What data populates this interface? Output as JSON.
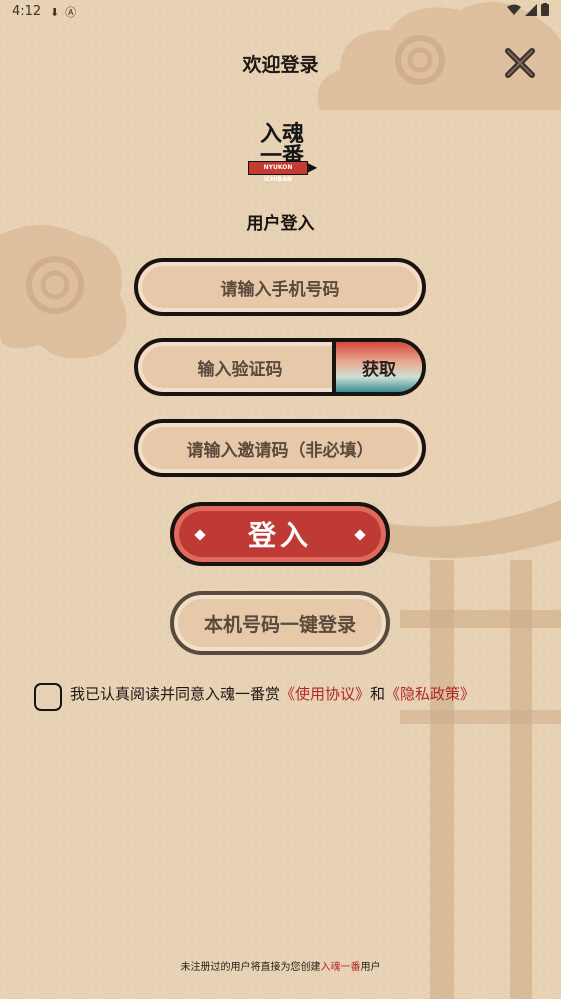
{
  "status_bar": {
    "time": "4:12",
    "left_icons": [
      "download-icon",
      "a-icon"
    ],
    "right_icons": [
      "wifi-icon",
      "signal-icon",
      "battery-icon"
    ]
  },
  "header": {
    "title": "欢迎登录",
    "close_icon": "close-icon"
  },
  "logo": {
    "line1": "入魂",
    "line2": "一番",
    "tag": "NYUKON ICHIBAN"
  },
  "form": {
    "subtitle": "用户登入",
    "phone_placeholder": "请输入手机号码",
    "code_placeholder": "输入验证码",
    "get_code_label": "获取",
    "invite_placeholder": "请输入邀请码（非必填）",
    "login_label": "登入",
    "onekey_label": "本机号码一键登录"
  },
  "agreement": {
    "checked": false,
    "prefix": "我已认真阅读并同意入魂一番赏",
    "terms_link": "《使用协议》",
    "conjunction": "和",
    "privacy_link": "《隐私政策》"
  },
  "footer": {
    "prefix": "未注册过的用户将直接为您创建",
    "brand": "入魂一番",
    "suffix": "用户"
  },
  "colors": {
    "background": "#e9d3b6",
    "accent_red": "#bf3a34",
    "link_red": "#b32a25",
    "outline": "#1a1410"
  }
}
